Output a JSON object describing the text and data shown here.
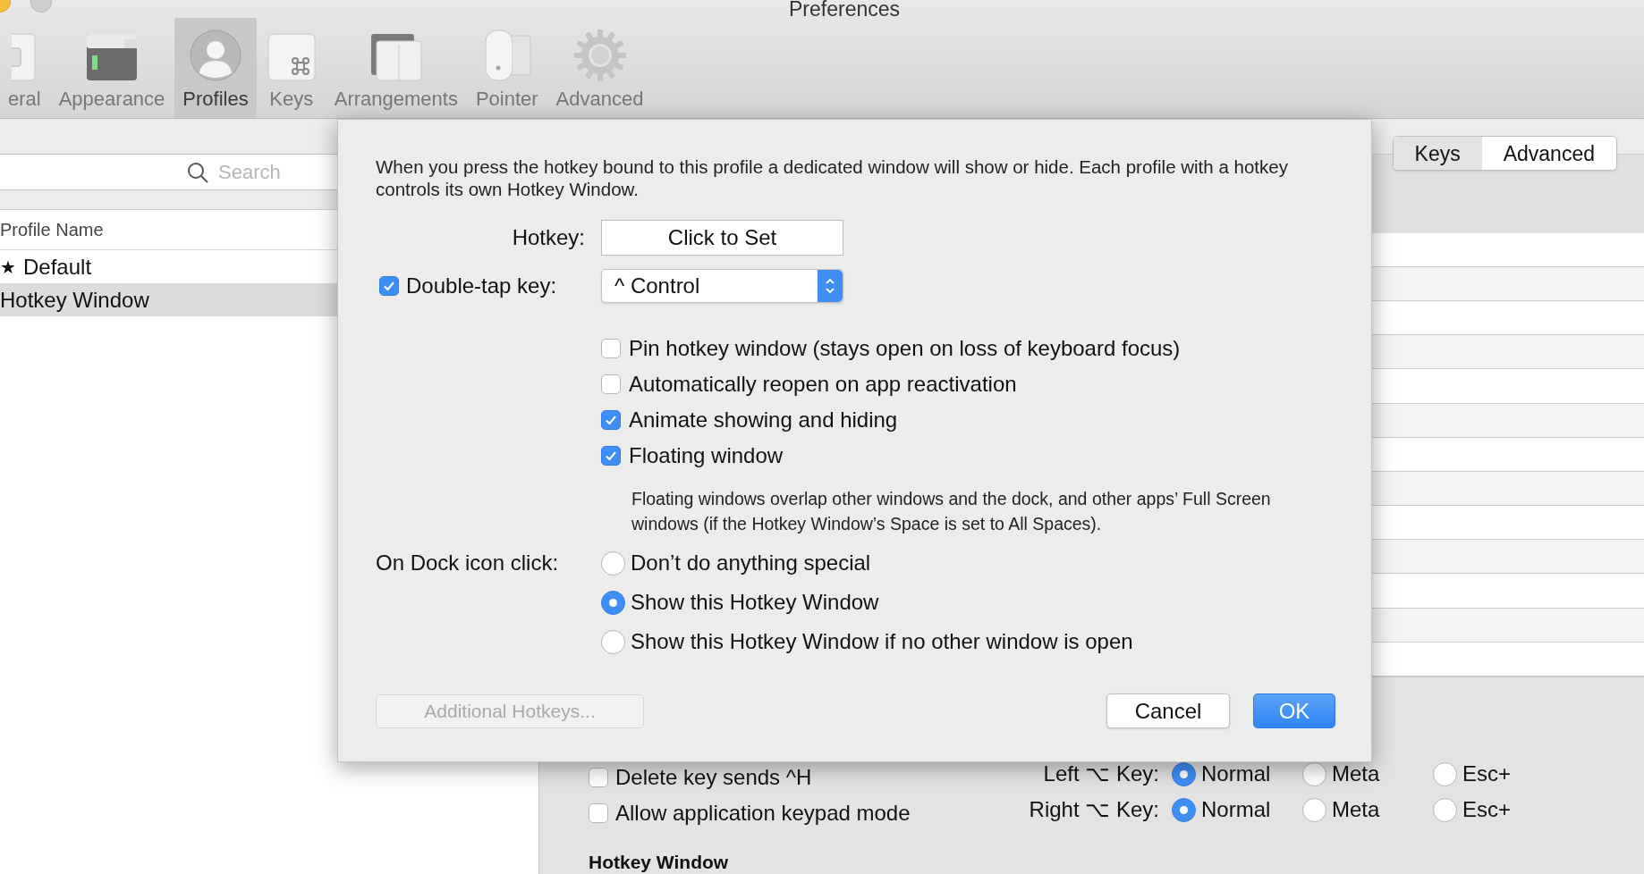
{
  "window": {
    "title": "Preferences"
  },
  "toolbar": [
    {
      "label": "eral",
      "kind": "general",
      "selected": false
    },
    {
      "label": "Appearance",
      "kind": "appearance",
      "selected": false
    },
    {
      "label": "Profiles",
      "kind": "profiles",
      "selected": true
    },
    {
      "label": "Keys",
      "kind": "keys",
      "selected": false
    },
    {
      "label": "Arrangements",
      "kind": "arrangements",
      "selected": false
    },
    {
      "label": "Pointer",
      "kind": "pointer",
      "selected": false
    },
    {
      "label": "Advanced",
      "kind": "advanced",
      "selected": false
    }
  ],
  "profiles_panel": {
    "search": {
      "placeholder": "Search"
    },
    "column": "Profile Name",
    "rows": [
      {
        "mark": "★",
        "name": "Default",
        "selected": false
      },
      {
        "name": "Hotkey Window",
        "selected": true
      }
    ]
  },
  "profile_tabs": [
    {
      "label": "Keys",
      "selected": false
    },
    {
      "label": "Advanced",
      "selected": true
    }
  ],
  "dialog": {
    "description": "When you press the hotkey bound to this profile a dedicated window will show or hide. Each profile with a hotkey controls its own Hotkey Window.",
    "hotkey_label": "Hotkey:",
    "hotkey_button": "Click to Set",
    "double_tap": {
      "label": "Double-tap key:",
      "checked": true,
      "value": "^ Control"
    },
    "options": [
      {
        "label": "Pin hotkey window (stays open on loss of keyboard focus)",
        "checked": false
      },
      {
        "label": "Automatically reopen on app reactivation",
        "checked": false
      },
      {
        "label": "Animate showing and hiding",
        "checked": true
      },
      {
        "label": "Floating window",
        "checked": true
      }
    ],
    "note": "Floating windows overlap other windows and the dock, and other apps’ Full Screen windows (if the Hotkey Window’s Space is set to All Spaces).",
    "dock_label": "On Dock icon click:",
    "dock_options": [
      {
        "label": "Don’t do anything special",
        "selected": false
      },
      {
        "label": "Show this Hotkey Window",
        "selected": true
      },
      {
        "label": "Show this Hotkey Window if no other window is open",
        "selected": false
      }
    ],
    "additional": {
      "label": "Additional Hotkeys...",
      "disabled": true
    },
    "cancel": "Cancel",
    "ok": "OK"
  },
  "keyboard_settings": {
    "checkboxes": [
      {
        "label": "Delete key sends ^H",
        "checked": false
      },
      {
        "label": "Allow application keypad mode",
        "checked": false
      }
    ],
    "option_keys": [
      {
        "label": "Left ⌥ Key:",
        "options": [
          {
            "label": "Normal",
            "selected": true
          },
          {
            "label": "Meta",
            "selected": false
          },
          {
            "label": "Esc+",
            "selected": false
          }
        ]
      },
      {
        "label": "Right ⌥ Key:",
        "options": [
          {
            "label": "Normal",
            "selected": true
          },
          {
            "label": "Meta",
            "selected": false
          },
          {
            "label": "Esc+",
            "selected": false
          }
        ]
      }
    ],
    "section_heading": "Hotkey Window"
  }
}
